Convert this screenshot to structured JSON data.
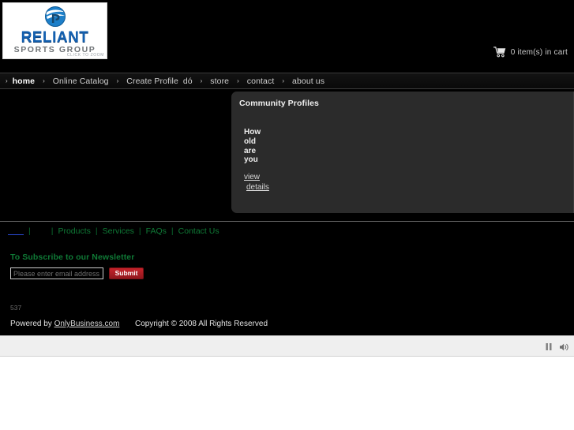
{
  "header": {
    "logo": {
      "word": "RELIANT",
      "sub": "SPORTS GROUP",
      "zoom_hint": "CLICK TO ZOOM",
      "icon": "globe-swoosh-icon"
    },
    "cart": {
      "icon": "shopping-cart-icon",
      "label": "0 item(s) in cart"
    }
  },
  "nav": {
    "arrow_glyph": "›",
    "items": [
      {
        "label": "home",
        "active": true
      },
      {
        "label": "Online Catalog",
        "active": false
      },
      {
        "label": "Create Profile",
        "active": false
      },
      {
        "label": "dó",
        "active": false
      },
      {
        "label": "store",
        "active": false
      },
      {
        "label": "contact",
        "active": false
      },
      {
        "label": "about us",
        "active": false
      }
    ]
  },
  "panel": {
    "title": "Community Profiles",
    "question_lines": [
      "How",
      "old",
      "are",
      "you"
    ],
    "link_lines": [
      "view",
      "details"
    ]
  },
  "footer": {
    "blank_link": "",
    "separator": "|",
    "links": [
      "Products",
      "Services",
      "FAQs",
      "Contact Us"
    ]
  },
  "newsletter": {
    "title": "To Subscribe to our Newsletter",
    "email_placeholder": "Please enter email address",
    "email_value": "",
    "submit_label": "Submit"
  },
  "credits": {
    "counter": "537",
    "powered_prefix": "Powered by ",
    "powered_link": "OnlyBusiness.com",
    "copyright": "Copyright ©  2008 All Rights Reserved"
  },
  "player": {
    "pause_icon": "pause-icon",
    "volume_icon": "speaker-volume-icon"
  },
  "colors": {
    "site_background": "#000000",
    "panel_background": "#2b2b2b",
    "link_green": "#0f7a36",
    "submit_red": "#c5232b",
    "logo_blue": "#1360b0",
    "player_bar": "#efefef"
  }
}
